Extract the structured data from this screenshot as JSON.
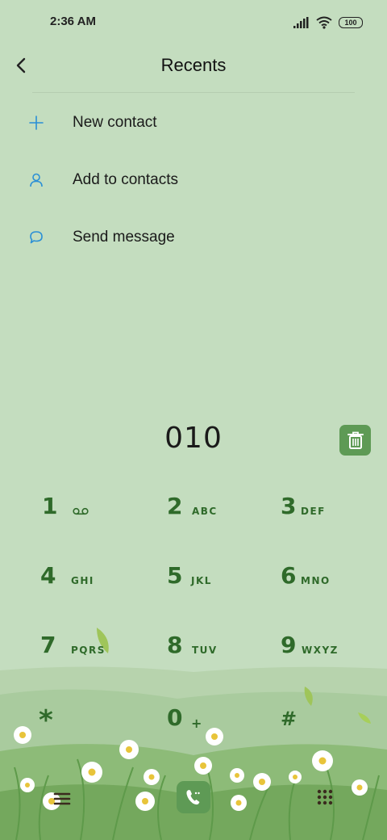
{
  "status_bar": {
    "time": "2:36 AM",
    "battery": "100",
    "icons": [
      "signal-icon",
      "wifi-icon",
      "battery-icon"
    ]
  },
  "header": {
    "title": "Recents",
    "back_icon": "back-arrow-icon"
  },
  "actions": [
    {
      "label": "New contact",
      "icon": "plus-icon"
    },
    {
      "label": "Add to contacts",
      "icon": "person-icon"
    },
    {
      "label": "Send message",
      "icon": "message-bubble-icon"
    }
  ],
  "dialed_number": "010",
  "keypad": [
    {
      "digit": "1",
      "letters": ""
    },
    {
      "digit": "2",
      "letters": "ABC"
    },
    {
      "digit": "3",
      "letters": "DEF"
    },
    {
      "digit": "4",
      "letters": "GHI"
    },
    {
      "digit": "5",
      "letters": "JKL"
    },
    {
      "digit": "6",
      "letters": "MNO"
    },
    {
      "digit": "7",
      "letters": "PQRS"
    },
    {
      "digit": "8",
      "letters": "TUV"
    },
    {
      "digit": "9",
      "letters": "WXYZ"
    },
    {
      "digit": "*",
      "letters": ""
    },
    {
      "digit": "0",
      "letters": "+"
    },
    {
      "digit": "#",
      "letters": ""
    }
  ],
  "colors": {
    "background": "#c4ddbf",
    "accent_green": "#5e9a55",
    "key_text": "#2f6a2a",
    "action_icon": "#2a8fd6"
  }
}
